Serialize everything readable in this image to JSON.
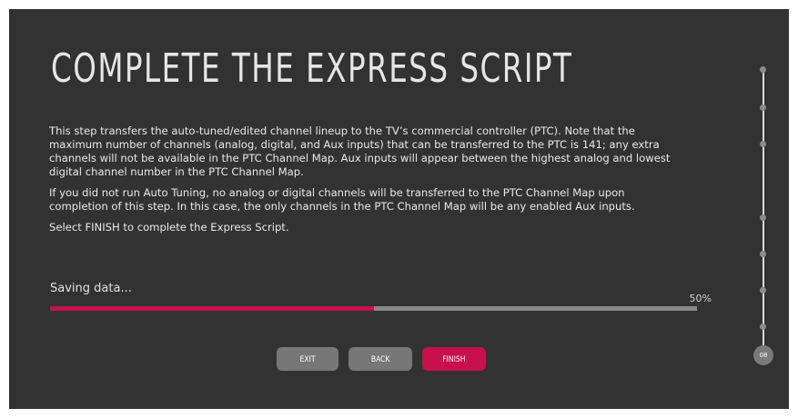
{
  "page": {
    "title": "COMPLETE THE EXPRESS SCRIPT",
    "paragraphs": [
      "This step transfers the auto-tuned/edited channel lineup to the TV’s commercial controller (PTC). Note that the maximum number of channels (analog, digital, and Aux inputs) that can be transferred to the PTC is 141; any extra channels will not be available in the PTC Channel Map. Aux inputs will appear between the highest analog and lowest digital channel number in the PTC Channel Map.",
      "If you did not run Auto Tuning, no analog or digital channels will be transferred to the PTC Channel Map upon completion of this step. In this case, the only channels in the PTC Channel Map will be any enabled Aux inputs.",
      "Select FINISH to complete the Express Script."
    ]
  },
  "progress": {
    "status_text": "Saving data...",
    "percent_label": "50%",
    "value": 0.5,
    "fill_color": "#c4124f",
    "track_color": "#8a8a8a"
  },
  "buttons": {
    "exit_label": "EXIT",
    "back_label": "BACK",
    "finish_label": "FINISH",
    "accent_color": "#c8104c"
  },
  "stepper": {
    "current_step_label": "08",
    "total_dots": 8
  }
}
